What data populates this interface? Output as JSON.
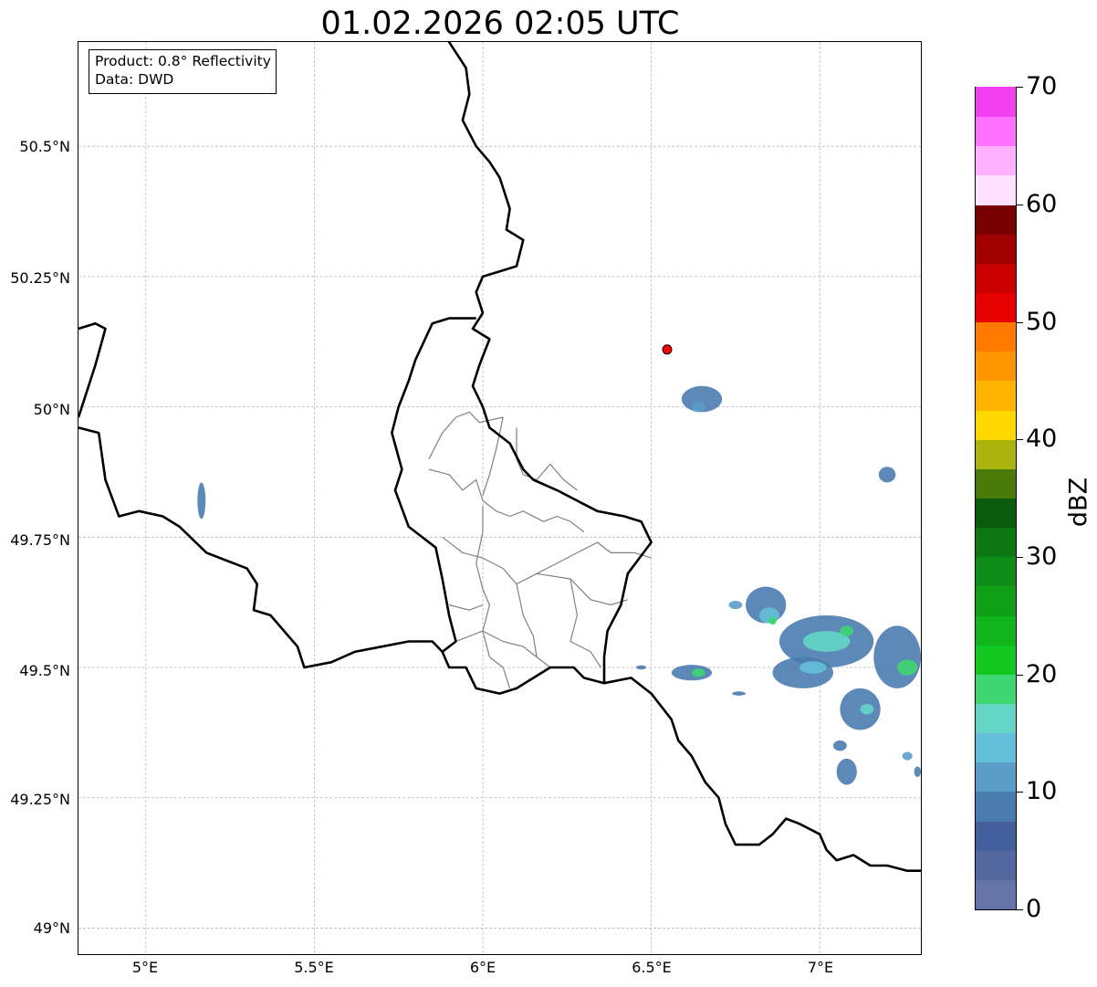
{
  "title": "01.02.2026 02:05 UTC",
  "info": {
    "product": "Product: 0.8° Reflectivity",
    "source": "Data: DWD"
  },
  "axes": {
    "lat_labels": [
      "50.5°N",
      "50.25°N",
      "50°N",
      "49.75°N",
      "49.5°N",
      "49.25°N",
      "49°N"
    ],
    "lon_labels": [
      "5°E",
      "5.5°E",
      "6°E",
      "6.5°E",
      "7°E"
    ]
  },
  "colorbar": {
    "unit": "dBZ",
    "tick_labels": [
      "0",
      "10",
      "20",
      "30",
      "40",
      "50",
      "60",
      "70"
    ],
    "colors": [
      "#6474a8",
      "#5468a0",
      "#44609c",
      "#4a7cb0",
      "#5a9ec8",
      "#64c0da",
      "#64d6c6",
      "#3ed670",
      "#12c820",
      "#10b41c",
      "#10a018",
      "#0e8c16",
      "#0c7814",
      "#0a5c0c",
      "#4a7a0a",
      "#aab40c",
      "#ffd800",
      "#ffb400",
      "#ff9600",
      "#ff7800",
      "#e60000",
      "#c80000",
      "#a00000",
      "#780000",
      "#ffe0ff",
      "#ffb0ff",
      "#ff70ff",
      "#f040f0"
    ]
  },
  "map_extent": {
    "lon": [
      4.8,
      7.3
    ],
    "lat": [
      48.95,
      50.7
    ]
  },
  "radar_site": {
    "lon": 6.547,
    "lat": 50.11,
    "color": "#ff0000"
  },
  "borders": {
    "national": [
      [
        [
          5.85,
          50.75
        ],
        [
          5.9,
          50.7
        ],
        [
          5.95,
          50.65
        ],
        [
          5.96,
          50.6
        ],
        [
          5.94,
          50.55
        ],
        [
          5.98,
          50.5
        ],
        [
          6.02,
          50.47
        ],
        [
          6.05,
          50.44
        ],
        [
          6.08,
          50.38
        ],
        [
          6.07,
          50.34
        ],
        [
          6.12,
          50.32
        ],
        [
          6.1,
          50.27
        ],
        [
          6.05,
          50.26
        ],
        [
          6.0,
          50.25
        ],
        [
          5.98,
          50.22
        ],
        [
          6.0,
          50.18
        ],
        [
          5.97,
          50.15
        ],
        [
          6.02,
          50.13
        ],
        [
          5.99,
          50.08
        ],
        [
          5.97,
          50.04
        ],
        [
          6.0,
          50.0
        ],
        [
          6.02,
          49.96
        ],
        [
          6.08,
          49.93
        ],
        [
          6.12,
          49.88
        ],
        [
          6.15,
          49.86
        ],
        [
          6.22,
          49.84
        ],
        [
          6.28,
          49.82
        ],
        [
          6.34,
          49.8
        ],
        [
          6.42,
          49.79
        ],
        [
          6.47,
          49.78
        ],
        [
          6.5,
          49.74
        ],
        [
          6.43,
          49.68
        ],
        [
          6.41,
          49.62
        ],
        [
          6.37,
          49.57
        ],
        [
          6.36,
          49.52
        ],
        [
          6.36,
          49.47
        ]
      ],
      [
        [
          4.8,
          50.15
        ],
        [
          4.85,
          50.16
        ],
        [
          4.88,
          50.15
        ],
        [
          4.85,
          50.08
        ],
        [
          4.82,
          50.02
        ],
        [
          4.8,
          49.98
        ]
      ],
      [
        [
          4.8,
          49.96
        ],
        [
          4.86,
          49.95
        ],
        [
          4.88,
          49.86
        ],
        [
          4.92,
          49.79
        ],
        [
          4.98,
          49.8
        ],
        [
          5.05,
          49.79
        ],
        [
          5.1,
          49.77
        ],
        [
          5.18,
          49.72
        ],
        [
          5.3,
          49.69
        ],
        [
          5.33,
          49.66
        ],
        [
          5.32,
          49.61
        ],
        [
          5.37,
          49.6
        ],
        [
          5.45,
          49.54
        ],
        [
          5.47,
          49.5
        ],
        [
          5.55,
          49.51
        ],
        [
          5.62,
          49.53
        ],
        [
          5.7,
          49.54
        ],
        [
          5.78,
          49.55
        ],
        [
          5.85,
          49.55
        ],
        [
          5.88,
          49.53
        ],
        [
          5.9,
          49.5
        ],
        [
          5.95,
          49.5
        ],
        [
          5.98,
          49.46
        ],
        [
          6.05,
          49.45
        ],
        [
          6.1,
          49.46
        ],
        [
          6.2,
          49.5
        ],
        [
          6.27,
          49.5
        ],
        [
          6.3,
          49.48
        ],
        [
          6.36,
          49.47
        ],
        [
          6.44,
          49.48
        ],
        [
          6.5,
          49.45
        ],
        [
          6.56,
          49.4
        ],
        [
          6.58,
          49.36
        ],
        [
          6.62,
          49.33
        ],
        [
          6.66,
          49.28
        ],
        [
          6.7,
          49.25
        ],
        [
          6.72,
          49.2
        ],
        [
          6.75,
          49.16
        ],
        [
          6.82,
          49.16
        ],
        [
          6.86,
          49.18
        ],
        [
          6.9,
          49.21
        ],
        [
          6.94,
          49.2
        ],
        [
          7.0,
          49.18
        ],
        [
          7.02,
          49.15
        ],
        [
          7.05,
          49.13
        ],
        [
          7.1,
          49.14
        ],
        [
          7.15,
          49.12
        ],
        [
          7.2,
          49.12
        ],
        [
          7.26,
          49.11
        ],
        [
          7.3,
          49.11
        ]
      ],
      [
        [
          5.98,
          50.17
        ],
        [
          5.9,
          50.17
        ],
        [
          5.85,
          50.16
        ],
        [
          5.8,
          50.09
        ],
        [
          5.78,
          50.05
        ],
        [
          5.75,
          50.0
        ],
        [
          5.73,
          49.95
        ],
        [
          5.76,
          49.88
        ],
        [
          5.74,
          49.84
        ],
        [
          5.78,
          49.77
        ],
        [
          5.86,
          49.73
        ],
        [
          5.88,
          49.67
        ],
        [
          5.9,
          49.6
        ],
        [
          5.92,
          49.55
        ],
        [
          5.88,
          49.53
        ]
      ]
    ],
    "cantons": [
      [
        [
          5.84,
          49.9
        ],
        [
          5.88,
          49.95
        ],
        [
          5.92,
          49.98
        ],
        [
          5.96,
          49.99
        ],
        [
          5.99,
          49.97
        ],
        [
          6.06,
          49.98
        ]
      ],
      [
        [
          5.84,
          49.88
        ],
        [
          5.9,
          49.87
        ],
        [
          5.94,
          49.84
        ],
        [
          5.98,
          49.86
        ],
        [
          6.0,
          49.82
        ],
        [
          6.04,
          49.8
        ],
        [
          6.08,
          49.79
        ],
        [
          6.12,
          49.8
        ],
        [
          6.18,
          49.78
        ],
        [
          6.22,
          49.79
        ],
        [
          6.26,
          49.78
        ],
        [
          6.3,
          49.76
        ]
      ],
      [
        [
          6.1,
          49.96
        ],
        [
          6.1,
          49.9
        ],
        [
          6.12,
          49.87
        ],
        [
          6.16,
          49.86
        ],
        [
          6.2,
          49.89
        ],
        [
          6.24,
          49.86
        ],
        [
          6.28,
          49.84
        ]
      ],
      [
        [
          6.06,
          49.98
        ],
        [
          6.04,
          49.92
        ],
        [
          6.02,
          49.87
        ],
        [
          6.0,
          49.83
        ]
      ],
      [
        [
          5.88,
          49.75
        ],
        [
          5.94,
          49.72
        ],
        [
          6.0,
          49.71
        ],
        [
          6.06,
          49.69
        ],
        [
          6.1,
          49.66
        ],
        [
          6.16,
          49.68
        ],
        [
          6.22,
          49.7
        ],
        [
          6.28,
          49.72
        ],
        [
          6.34,
          49.74
        ],
        [
          6.38,
          49.72
        ],
        [
          6.45,
          49.72
        ],
        [
          6.5,
          49.71
        ]
      ],
      [
        [
          6.0,
          49.81
        ],
        [
          6.0,
          49.76
        ],
        [
          5.98,
          49.7
        ],
        [
          6.0,
          49.65
        ],
        [
          6.02,
          49.62
        ],
        [
          6.0,
          49.57
        ],
        [
          6.02,
          49.52
        ],
        [
          6.06,
          49.5
        ],
        [
          6.08,
          49.46
        ]
      ],
      [
        [
          6.1,
          49.66
        ],
        [
          6.12,
          49.6
        ],
        [
          6.15,
          49.56
        ],
        [
          6.16,
          49.52
        ],
        [
          6.2,
          49.5
        ]
      ],
      [
        [
          6.16,
          49.68
        ],
        [
          6.26,
          49.67
        ],
        [
          6.32,
          49.63
        ],
        [
          6.38,
          49.62
        ],
        [
          6.43,
          49.63
        ]
      ],
      [
        [
          5.9,
          49.62
        ],
        [
          5.96,
          49.61
        ],
        [
          6.0,
          49.62
        ]
      ],
      [
        [
          5.92,
          49.55
        ],
        [
          6.0,
          49.57
        ],
        [
          6.06,
          49.55
        ],
        [
          6.12,
          49.54
        ],
        [
          6.16,
          49.52
        ]
      ],
      [
        [
          6.26,
          49.67
        ],
        [
          6.28,
          49.6
        ],
        [
          6.26,
          49.55
        ],
        [
          6.32,
          49.53
        ],
        [
          6.35,
          49.5
        ]
      ]
    ]
  },
  "echoes": [
    {
      "lon": 6.65,
      "lat": 50.015,
      "rx": 0.06,
      "ry": 0.025,
      "c": "#4a7cb0"
    },
    {
      "lon": 6.64,
      "lat": 50.0,
      "rx": 0.02,
      "ry": 0.01,
      "c": "#5a9ec8"
    },
    {
      "lon": 5.165,
      "lat": 49.82,
      "rx": 0.012,
      "ry": 0.035,
      "c": "#4a7cb0"
    },
    {
      "lon": 7.2,
      "lat": 49.87,
      "rx": 0.025,
      "ry": 0.015,
      "c": "#4a7cb0"
    },
    {
      "lon": 6.84,
      "lat": 49.62,
      "rx": 0.06,
      "ry": 0.035,
      "c": "#4a7cb0"
    },
    {
      "lon": 6.85,
      "lat": 49.6,
      "rx": 0.03,
      "ry": 0.015,
      "c": "#64c0da"
    },
    {
      "lon": 6.86,
      "lat": 49.59,
      "rx": 0.012,
      "ry": 0.008,
      "c": "#3ed670"
    },
    {
      "lon": 6.75,
      "lat": 49.62,
      "rx": 0.02,
      "ry": 0.008,
      "c": "#5a9ec8"
    },
    {
      "lon": 7.02,
      "lat": 49.55,
      "rx": 0.14,
      "ry": 0.05,
      "c": "#4a7cb0"
    },
    {
      "lon": 7.02,
      "lat": 49.55,
      "rx": 0.07,
      "ry": 0.02,
      "c": "#64d6c6"
    },
    {
      "lon": 7.08,
      "lat": 49.57,
      "rx": 0.02,
      "ry": 0.01,
      "c": "#3ed670"
    },
    {
      "lon": 6.95,
      "lat": 49.49,
      "rx": 0.09,
      "ry": 0.03,
      "c": "#4a7cb0"
    },
    {
      "lon": 6.98,
      "lat": 49.5,
      "rx": 0.04,
      "ry": 0.012,
      "c": "#64c0da"
    },
    {
      "lon": 6.62,
      "lat": 49.49,
      "rx": 0.06,
      "ry": 0.015,
      "c": "#4a7cb0"
    },
    {
      "lon": 6.64,
      "lat": 49.49,
      "rx": 0.02,
      "ry": 0.008,
      "c": "#3ed670"
    },
    {
      "lon": 7.23,
      "lat": 49.52,
      "rx": 0.07,
      "ry": 0.06,
      "c": "#4a7cb0"
    },
    {
      "lon": 7.26,
      "lat": 49.5,
      "rx": 0.03,
      "ry": 0.015,
      "c": "#3ed670"
    },
    {
      "lon": 7.12,
      "lat": 49.42,
      "rx": 0.06,
      "ry": 0.04,
      "c": "#4a7cb0"
    },
    {
      "lon": 7.14,
      "lat": 49.42,
      "rx": 0.02,
      "ry": 0.01,
      "c": "#64d6c6"
    },
    {
      "lon": 7.08,
      "lat": 49.3,
      "rx": 0.03,
      "ry": 0.025,
      "c": "#4a7cb0"
    },
    {
      "lon": 7.06,
      "lat": 49.35,
      "rx": 0.02,
      "ry": 0.01,
      "c": "#4a7cb0"
    },
    {
      "lon": 7.26,
      "lat": 49.33,
      "rx": 0.015,
      "ry": 0.008,
      "c": "#5a9ec8"
    },
    {
      "lon": 7.29,
      "lat": 49.3,
      "rx": 0.01,
      "ry": 0.01,
      "c": "#4a7cb0"
    },
    {
      "lon": 6.76,
      "lat": 49.45,
      "rx": 0.02,
      "ry": 0.004,
      "c": "#4a7cb0"
    },
    {
      "lon": 6.47,
      "lat": 49.5,
      "rx": 0.015,
      "ry": 0.004,
      "c": "#4a7cb0"
    }
  ]
}
